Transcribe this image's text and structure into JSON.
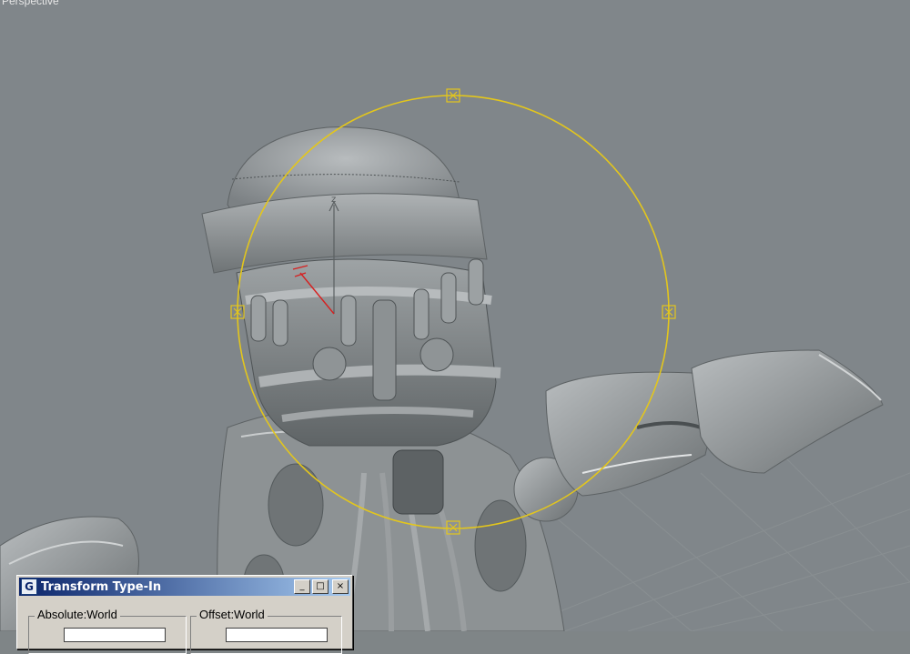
{
  "viewport": {
    "label": "Perspective"
  },
  "gizmo": {
    "color": "#e3c61c",
    "axis_label": "z"
  },
  "dialog": {
    "title": "Transform Type-In",
    "buttons": {
      "minimize": "_",
      "maximize": "□",
      "close": "×"
    },
    "groups": {
      "absolute": "Absolute:World",
      "offset": "Offset:World"
    }
  },
  "colors": {
    "viewport_bg": "#80868a",
    "titlebar_start": "#0a246a",
    "titlebar_end": "#a6caf0",
    "dialog_bg": "#d4d0c8"
  }
}
